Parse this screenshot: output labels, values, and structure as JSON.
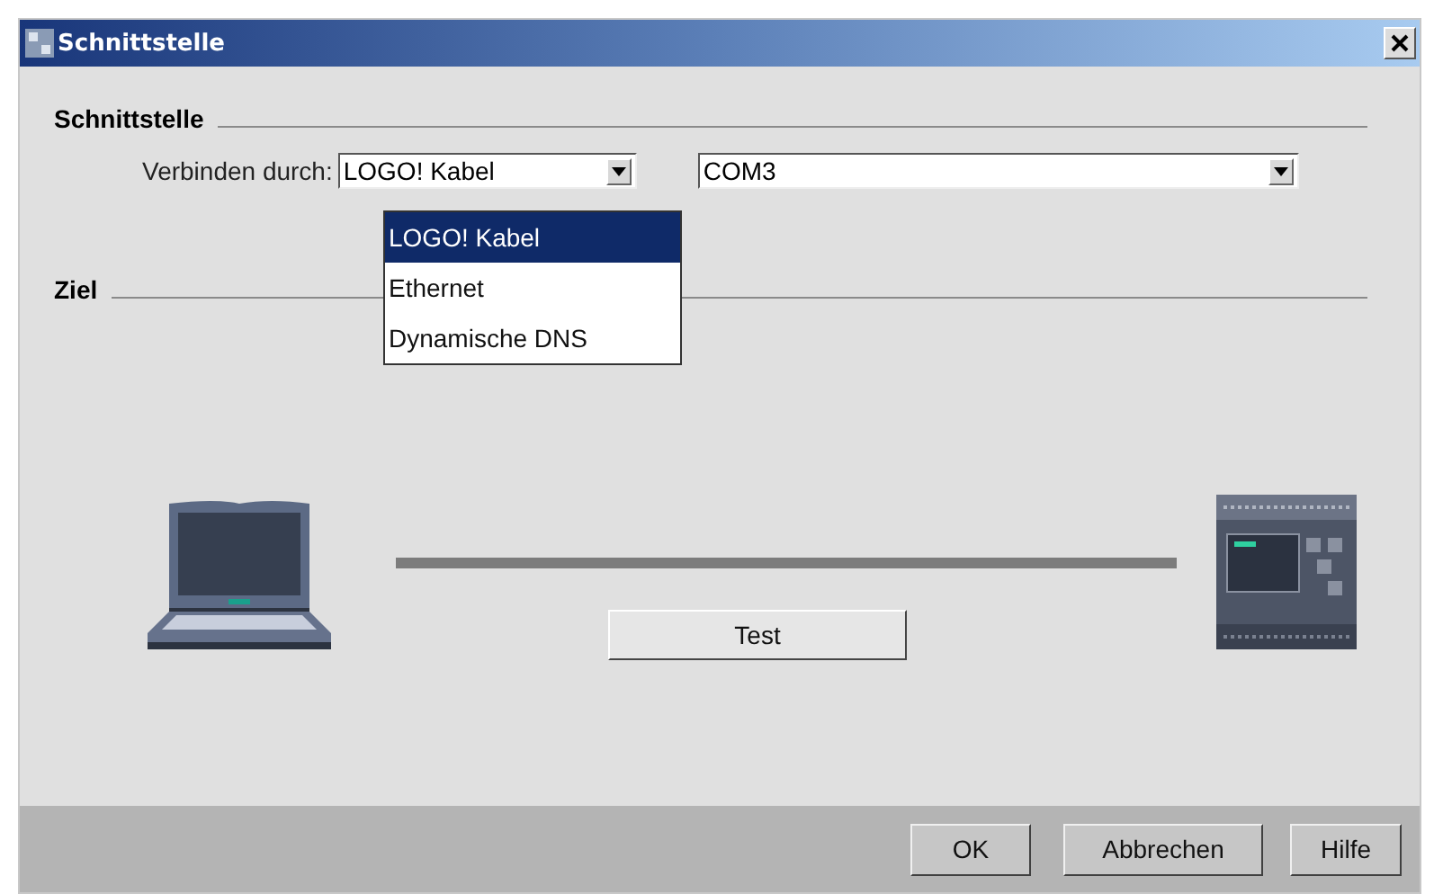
{
  "window": {
    "title": "Schnittstelle"
  },
  "interface_section": {
    "heading": "Schnittstelle",
    "connect_label": "Verbinden durch:",
    "connection_combo": {
      "value": "LOGO! Kabel",
      "expanded": true,
      "options": [
        {
          "label": "LOGO! Kabel",
          "selected": true
        },
        {
          "label": "Ethernet",
          "selected": false
        },
        {
          "label": "Dynamische DNS",
          "selected": false
        }
      ]
    },
    "port_combo": {
      "value": "COM3"
    }
  },
  "target_section": {
    "heading": "Ziel",
    "test_button": "Test"
  },
  "buttons": [
    "OK",
    "Abbrechen",
    "Hilfe"
  ]
}
